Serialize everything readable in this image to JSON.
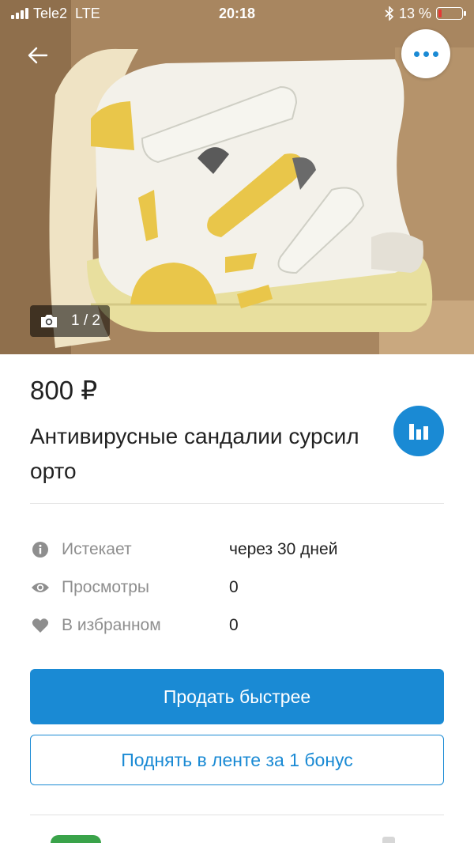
{
  "status_bar": {
    "carrier": "Tele2",
    "network": "LTE",
    "time": "20:18",
    "battery_text": "13 %",
    "battery_level": 0.13
  },
  "photo": {
    "counter": "1 / 2"
  },
  "listing": {
    "price": "800 ₽",
    "title": "Антивирусные сандалии сурсил орто"
  },
  "info": {
    "expires_label": "Истекает",
    "expires_value": "через 30 дней",
    "views_label": "Просмотры",
    "views_value": "0",
    "favorites_label": "В избранном",
    "favorites_value": "0"
  },
  "actions": {
    "sell_faster": "Продать быстрее",
    "boost": "Поднять в ленте за 1 бонус"
  },
  "colors": {
    "accent": "#1a8ad4",
    "battery_low": "#e53935"
  },
  "icons": {
    "back": "arrow-left-icon",
    "more": "more-dots-icon",
    "camera": "camera-icon",
    "stats": "bar-chart-icon",
    "info": "info-icon",
    "views": "eye-icon",
    "favorites": "heart-icon"
  }
}
